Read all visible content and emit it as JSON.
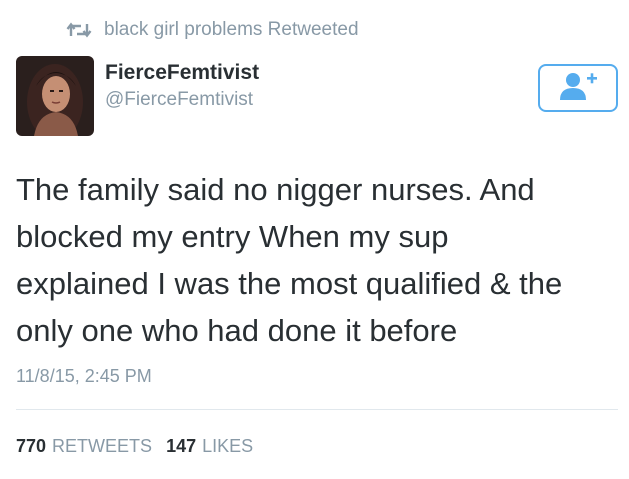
{
  "retweet_header": {
    "text": "black girl problems Retweeted",
    "icon": "retweet-icon"
  },
  "user": {
    "name": "FierceFemtivist",
    "handle": "@FierceFemtivist",
    "avatar_icon": "avatar-photo"
  },
  "follow_button": {
    "icon": "follow-person-plus-icon"
  },
  "tweet": {
    "lines": [
      "The family said no nigger nurses. And",
      "blocked my entry When my sup",
      "explained I was the most qualified & the",
      "only one who had done it before"
    ],
    "timestamp": "11/8/15, 2:45 PM"
  },
  "stats": {
    "retweets_count": "770",
    "retweets_label": "RETWEETS",
    "likes_count": "147",
    "likes_label": "LIKES"
  },
  "colors": {
    "accent": "#55acee",
    "secondary_text": "#8899a6",
    "primary_text": "#292f33",
    "divider": "#e1e8ed"
  }
}
